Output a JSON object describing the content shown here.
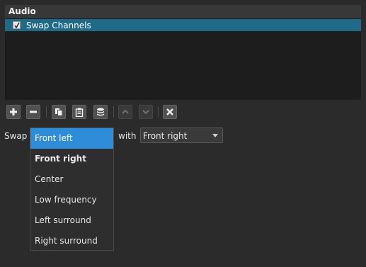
{
  "panel": {
    "header": "Audio",
    "filters": [
      {
        "label": "Swap Channels",
        "checked": true
      }
    ]
  },
  "toolbar": {
    "buttons": [
      {
        "name": "add-filter-button",
        "icon": "plus-icon"
      },
      {
        "name": "remove-filter-button",
        "icon": "minus-icon"
      },
      {
        "name": "copy-filter-button",
        "icon": "copy-icon"
      },
      {
        "name": "paste-filter-button",
        "icon": "paste-icon"
      },
      {
        "name": "presets-button",
        "icon": "stack-icon"
      },
      {
        "name": "move-up-button",
        "icon": "chevron-up-icon"
      },
      {
        "name": "move-down-button",
        "icon": "chevron-down-icon"
      },
      {
        "name": "close-filter-button",
        "icon": "close-icon"
      }
    ]
  },
  "swap": {
    "label": "Swap",
    "with_label": "with",
    "target_value": "Front right",
    "options": [
      "Front left",
      "Front right",
      "Center",
      "Low frequency",
      "Left surround",
      "Right surround"
    ],
    "highlighted": "Front left"
  },
  "colors": {
    "selection_row": "#1f6a88",
    "highlight": "#2f8cd8",
    "background": "#2b2b2b"
  }
}
